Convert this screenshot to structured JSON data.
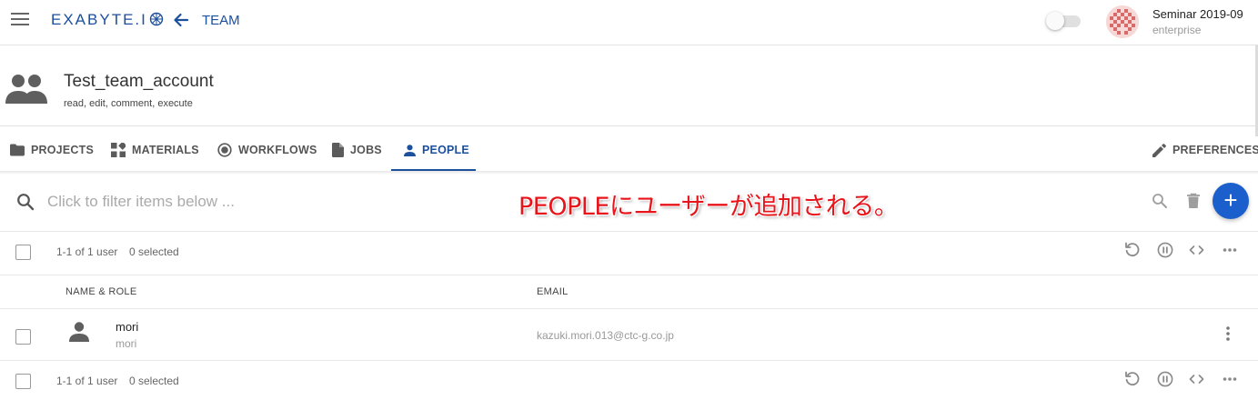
{
  "header": {
    "logo_text": "EXABYTE.I",
    "breadcrumb": "TEAM",
    "user_name": "Seminar 2019-09",
    "user_plan": "enterprise"
  },
  "account": {
    "title": "Test_team_account",
    "permissions": "read, edit, comment, execute"
  },
  "tabs": [
    {
      "label": "PROJECTS",
      "icon": "folder-icon",
      "active": false
    },
    {
      "label": "MATERIALS",
      "icon": "materials-icon",
      "active": false
    },
    {
      "label": "WORKFLOWS",
      "icon": "workflows-icon",
      "active": false
    },
    {
      "label": "JOBS",
      "icon": "file-icon",
      "active": false
    },
    {
      "label": "PEOPLE",
      "icon": "person-icon",
      "active": true
    },
    {
      "label": "PREFERENCES",
      "icon": "pencil-icon",
      "active": false
    }
  ],
  "filter": {
    "placeholder": "Click to filter items below ..."
  },
  "annotation": "PEOPLEにユーザーが追加される。",
  "list": {
    "range_text": "1-1 of 1 user",
    "selected_text": "0 selected",
    "columns": {
      "name_role": "NAME & ROLE",
      "email": "EMAIL"
    },
    "rows": [
      {
        "name": "mori",
        "role": "mori",
        "email": "kazuki.mori.013@ctc-g.co.jp"
      }
    ]
  },
  "colors": {
    "brand": "#1c4f9c",
    "fab": "#1b5fcc",
    "annotation": "#e8141b"
  }
}
